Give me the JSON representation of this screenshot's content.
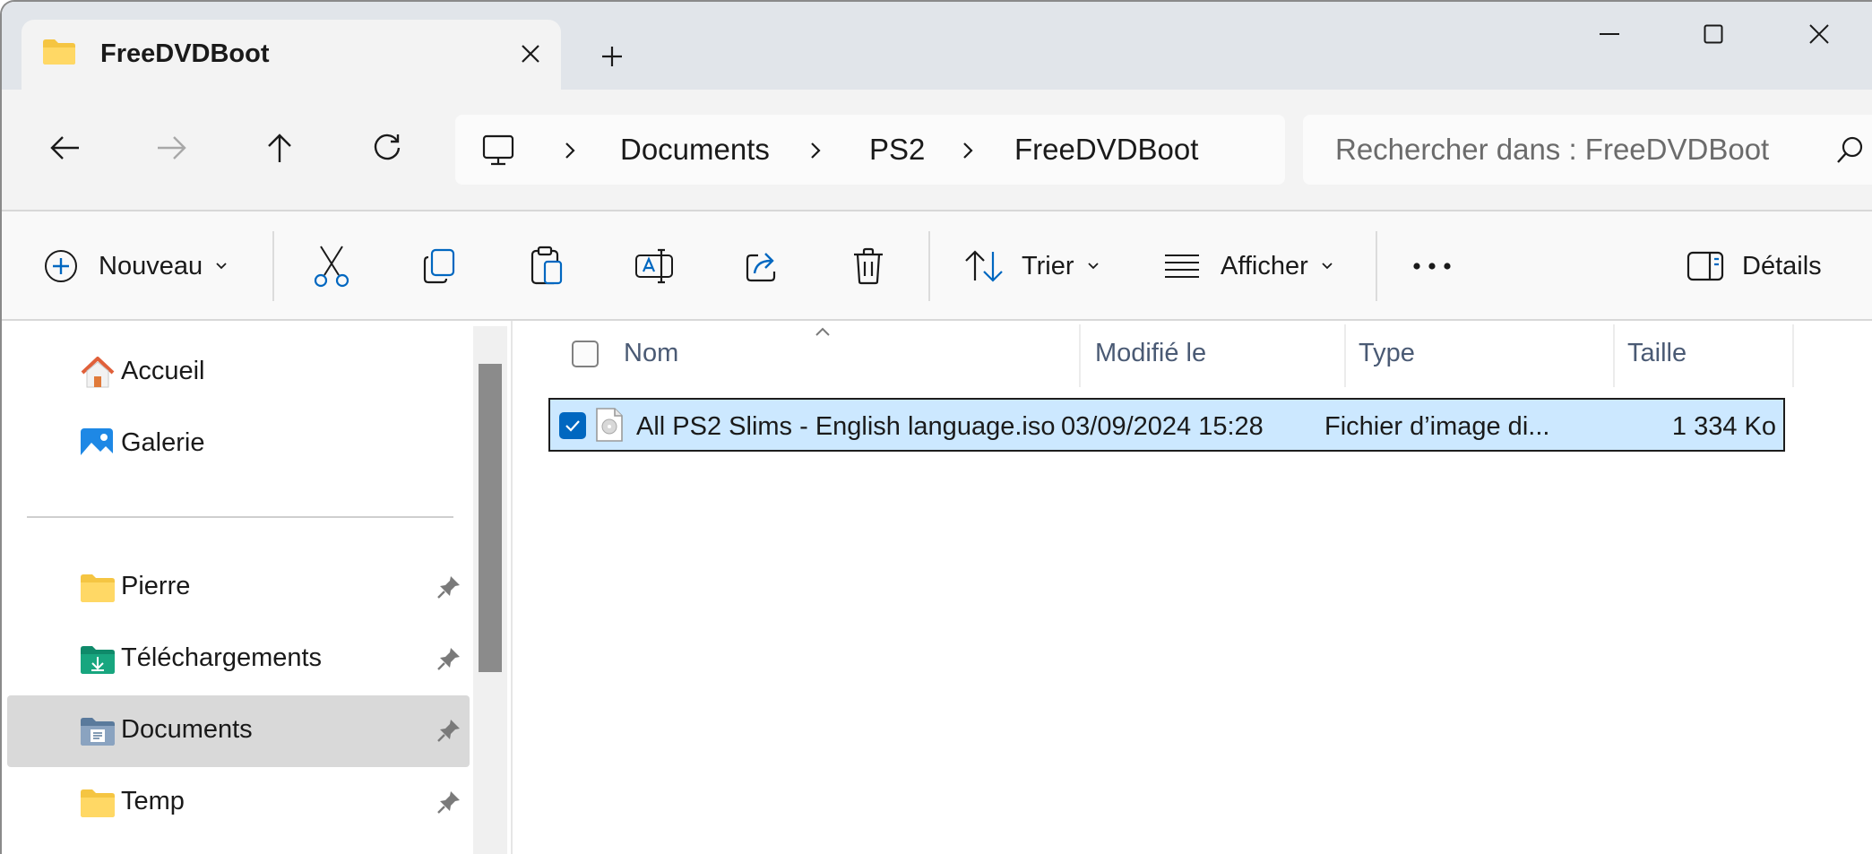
{
  "window": {
    "tab_title": "FreeDVDBoot",
    "colors": {
      "titlebar": "#e1e5ea",
      "accent": "#0067c0",
      "selection": "#cce8ff"
    }
  },
  "address_bar": {
    "crumbs": [
      "Documents",
      "PS2",
      "FreeDVDBoot"
    ]
  },
  "search": {
    "placeholder": "Rechercher dans : FreeDVDBoot"
  },
  "command_bar": {
    "new_label": "Nouveau",
    "sort_label": "Trier",
    "view_label": "Afficher",
    "details_label": "Détails",
    "icons": [
      "cut-icon",
      "copy-icon",
      "paste-icon",
      "rename-icon",
      "share-icon",
      "delete-icon",
      "more-icon"
    ]
  },
  "sidebar": {
    "quick": [
      {
        "label": "Accueil",
        "icon": "home-icon"
      },
      {
        "label": "Galerie",
        "icon": "gallery-icon"
      }
    ],
    "pinned": [
      {
        "label": "Pierre",
        "icon": "folder-icon"
      },
      {
        "label": "Téléchargements",
        "icon": "downloads-folder-icon"
      },
      {
        "label": "Documents",
        "icon": "documents-folder-icon",
        "selected": true
      },
      {
        "label": "Temp",
        "icon": "folder-icon"
      }
    ]
  },
  "file_list": {
    "columns": {
      "name": "Nom",
      "modified": "Modifié le",
      "type": "Type",
      "size": "Taille"
    },
    "sort_column": "Nom",
    "rows": [
      {
        "name": "All PS2 Slims - English language.iso",
        "modified": "03/09/2024 15:28",
        "type": "Fichier d’image di...",
        "size": "1 334 Ko",
        "selected": true,
        "checked": true
      }
    ]
  }
}
